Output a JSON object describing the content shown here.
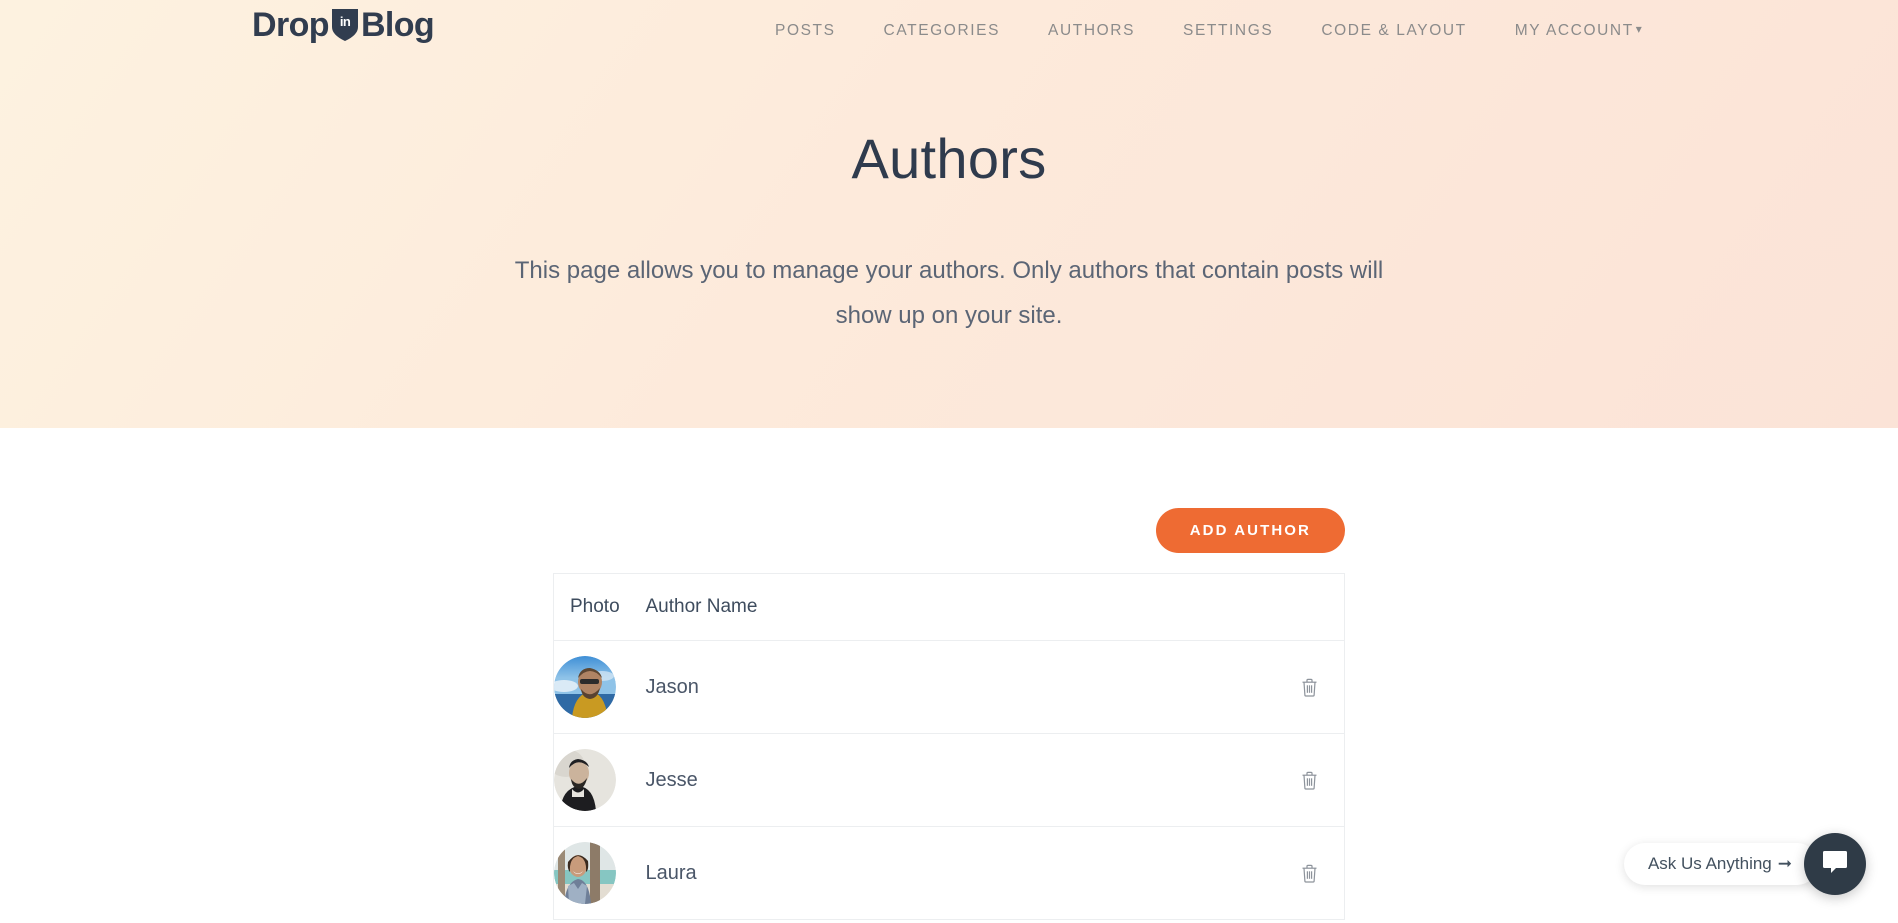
{
  "brand": {
    "logo_word1": "Drop",
    "logo_badge": "in",
    "logo_word2": "Blog",
    "logo_color": "#313d4f"
  },
  "nav": {
    "items": [
      {
        "label": "POSTS",
        "name": "nav-link-posts"
      },
      {
        "label": "CATEGORIES",
        "name": "nav-link-categories"
      },
      {
        "label": "AUTHORS",
        "name": "nav-link-authors"
      },
      {
        "label": "SETTINGS",
        "name": "nav-link-settings"
      },
      {
        "label": "CODE & LAYOUT",
        "name": "nav-link-code-layout"
      },
      {
        "label": "MY ACCOUNT",
        "name": "nav-link-my-account",
        "caret": "▾"
      }
    ],
    "account_caret": "▾"
  },
  "hero": {
    "title": "Authors",
    "subtitle": "This page allows you to manage your authors. Only authors that contain posts will show up on your site.",
    "gradient_start": "#fdf2e0",
    "gradient_end": "#fbe3d7"
  },
  "toolbar": {
    "add_author_label": "ADD AUTHOR",
    "accent_color": "#ee6b33"
  },
  "table": {
    "headers": {
      "photo": "Photo",
      "author_name": "Author Name",
      "actions": ""
    },
    "rows": [
      {
        "name": "Jason",
        "photo": "avatar-jason",
        "delete_icon": "trash-icon"
      },
      {
        "name": "Jesse",
        "photo": "avatar-jesse",
        "delete_icon": "trash-icon"
      },
      {
        "name": "Laura",
        "photo": "avatar-laura",
        "delete_icon": "trash-icon"
      }
    ]
  },
  "chat": {
    "prompt": "Ask Us Anything",
    "arrow": "➞",
    "icon": "chat-bubble-icon",
    "circle_color": "#2f3b47"
  }
}
